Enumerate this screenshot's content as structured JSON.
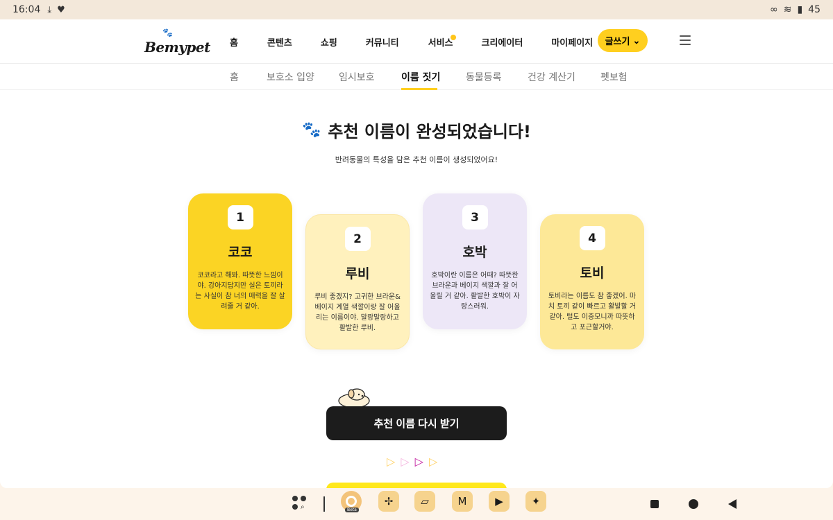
{
  "status_bar": {
    "time": "16:04",
    "battery": "45"
  },
  "header": {
    "logo": "Bemypet",
    "nav": [
      "홈",
      "콘텐츠",
      "쇼핑",
      "커뮤니티",
      "서비스",
      "크리에이터",
      "마이페이지"
    ],
    "write_button": "글쓰기",
    "write_chevron": "⌄"
  },
  "subnav": {
    "items": [
      "홈",
      "보호소 입양",
      "임시보호",
      "이름 짓기",
      "동물등록",
      "건강 계산기",
      "펫보험"
    ],
    "active_index": 3
  },
  "main": {
    "title": "추천 이름이 완성되었습니다!",
    "subtitle": "반려동물의 특성을 담은 추천 이름이 생성되었어요!",
    "cards": [
      {
        "number": "1",
        "name": "코코",
        "desc": "코코라고 해봐. 따뜻한 느낌이야. 강아지답지만 실은 토끼라는 사실이 참 너의 매력을 잘 살려줄 거 같아."
      },
      {
        "number": "2",
        "name": "루비",
        "desc": "루비 좋겠지? 고귀한 브라운& 베이지 계열 색깔이랑 잘 어울리는 이름이야. 말랑말랑하고 활발한 루비."
      },
      {
        "number": "3",
        "name": "호박",
        "desc": "호박이란 이름은 어때? 따뜻한 브라운과 베이지 색깔과 잘 어울릴 거 같아. 활발한 호박이 자랑스러워."
      },
      {
        "number": "4",
        "name": "토비",
        "desc": "토비라는 이름도 참 좋겠어. 마치 토끼 같이 빠르고 활발할 거 같아. 털도 이중모니까 따뜻하고 포근할거야."
      }
    ],
    "cta_button": "추천 이름 다시 받기",
    "arrows": [
      "▷",
      "▷",
      "▷",
      "▷"
    ]
  },
  "taskbar": {
    "beta_label": "Beta",
    "apps": [
      "chrome-beta-icon",
      "pinwheel-icon",
      "photos-icon",
      "gmail-icon",
      "youtube-icon",
      "sparkle-icon"
    ]
  }
}
